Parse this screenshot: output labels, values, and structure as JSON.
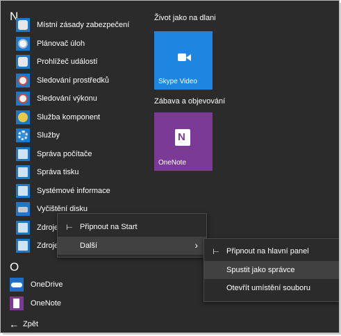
{
  "app_list": {
    "section_n": "N",
    "section_o": "O",
    "items_n": [
      {
        "label": "Místní zásady zabezpečení",
        "icon": "security-policy-icon"
      },
      {
        "label": "Plánovač úloh",
        "icon": "task-scheduler-icon"
      },
      {
        "label": "Prohlížeč událostí",
        "icon": "event-viewer-icon"
      },
      {
        "label": "Sledování prostředků",
        "icon": "resource-monitor-icon"
      },
      {
        "label": "Sledování výkonu",
        "icon": "performance-monitor-icon"
      },
      {
        "label": "Služba komponent",
        "icon": "component-services-icon"
      },
      {
        "label": "Služby",
        "icon": "services-gear-icon"
      },
      {
        "label": "Správa počítače",
        "icon": "computer-management-icon"
      },
      {
        "label": "Správa tisku",
        "icon": "print-management-icon"
      },
      {
        "label": "Systémové informace",
        "icon": "system-information-icon"
      },
      {
        "label": "Vyčištění disku",
        "icon": "disk-cleanup-icon"
      },
      {
        "label": "Zdroje dat ODBC (32bitové)",
        "icon": "odbc-icon"
      },
      {
        "label": "Zdroje dat ODBC (64bitové)",
        "icon": "odbc-icon"
      }
    ],
    "items_o": [
      {
        "label": "OneDrive",
        "icon": "onedrive-icon"
      },
      {
        "label": "OneNote",
        "icon": "onenote-icon"
      }
    ],
    "back_label": "Zpět"
  },
  "tiles": {
    "group1_title": "Život jako na dlani",
    "group2_title": "Zábava a objevování",
    "skype_label": "Skype Video",
    "onenote_label": "OneNote",
    "skype_color": "#1e85e0",
    "onenote_color": "#7a3a96"
  },
  "context_menu": {
    "pin_start": "Připnout na Start",
    "more": "Další"
  },
  "submenu": {
    "pin_taskbar": "Připnout na hlavní panel",
    "run_as_admin": "Spustit jako správce",
    "open_location": "Otevřít umístění souboru"
  }
}
